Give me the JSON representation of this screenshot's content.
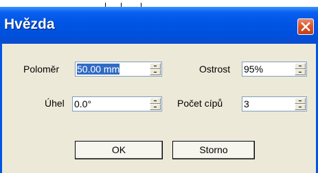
{
  "dialog": {
    "title": "Hvězda",
    "close_icon": "close-icon"
  },
  "fields": {
    "radius": {
      "label": "Poloměr",
      "value": "50.00 mm"
    },
    "angle": {
      "label": "Úhel",
      "value": "0.0°"
    },
    "sharpness": {
      "label": "Ostrost",
      "value": "95%"
    },
    "points": {
      "label": "Počet cípů",
      "value": "3"
    }
  },
  "buttons": {
    "ok": "OK",
    "cancel": "Storno"
  },
  "colors": {
    "title_bar": "#0054e3",
    "close_button": "#d9542a",
    "dialog_background": "#ece9d8",
    "selection": "#316ac5"
  }
}
